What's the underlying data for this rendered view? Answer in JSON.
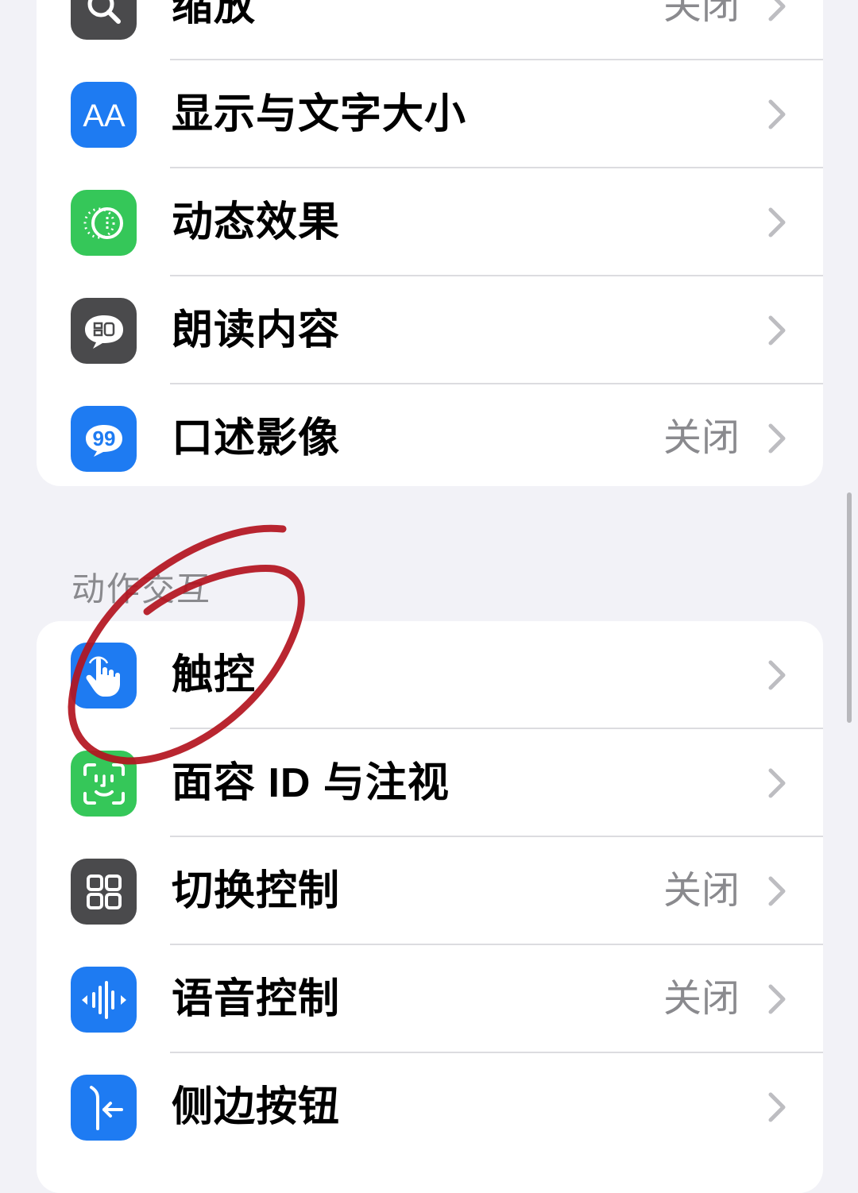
{
  "group_vision": {
    "rows": [
      {
        "label": "缩放",
        "value": "关闭",
        "icon": "zoom-icon",
        "color": "#4A4A4C"
      },
      {
        "label": "显示与文字大小",
        "value": "",
        "icon": "text-size-icon",
        "color": "#1E7BF2"
      },
      {
        "label": "动态效果",
        "value": "",
        "icon": "motion-icon",
        "color": "#35C759"
      },
      {
        "label": "朗读内容",
        "value": "",
        "icon": "spoken-content-icon",
        "color": "#4A4A4C"
      },
      {
        "label": "口述影像",
        "value": "关闭",
        "icon": "audio-description-icon",
        "color": "#1E7BF2"
      }
    ]
  },
  "section_header": "动作交互",
  "group_interaction": {
    "rows": [
      {
        "label": "触控",
        "value": "",
        "icon": "touch-hand-icon",
        "color": "#1E7BF2"
      },
      {
        "label": "面容 ID 与注视",
        "value": "",
        "icon": "face-id-icon",
        "color": "#35C759"
      },
      {
        "label": "切换控制",
        "value": "关闭",
        "icon": "switch-control-icon",
        "color": "#4A4A4C"
      },
      {
        "label": "语音控制",
        "value": "关闭",
        "icon": "voice-control-icon",
        "color": "#1E7BF2"
      },
      {
        "label": "侧边按钮",
        "value": "",
        "icon": "side-button-icon",
        "color": "#1E7BF2"
      }
    ]
  },
  "annotation": {
    "color": "#B3131E"
  }
}
